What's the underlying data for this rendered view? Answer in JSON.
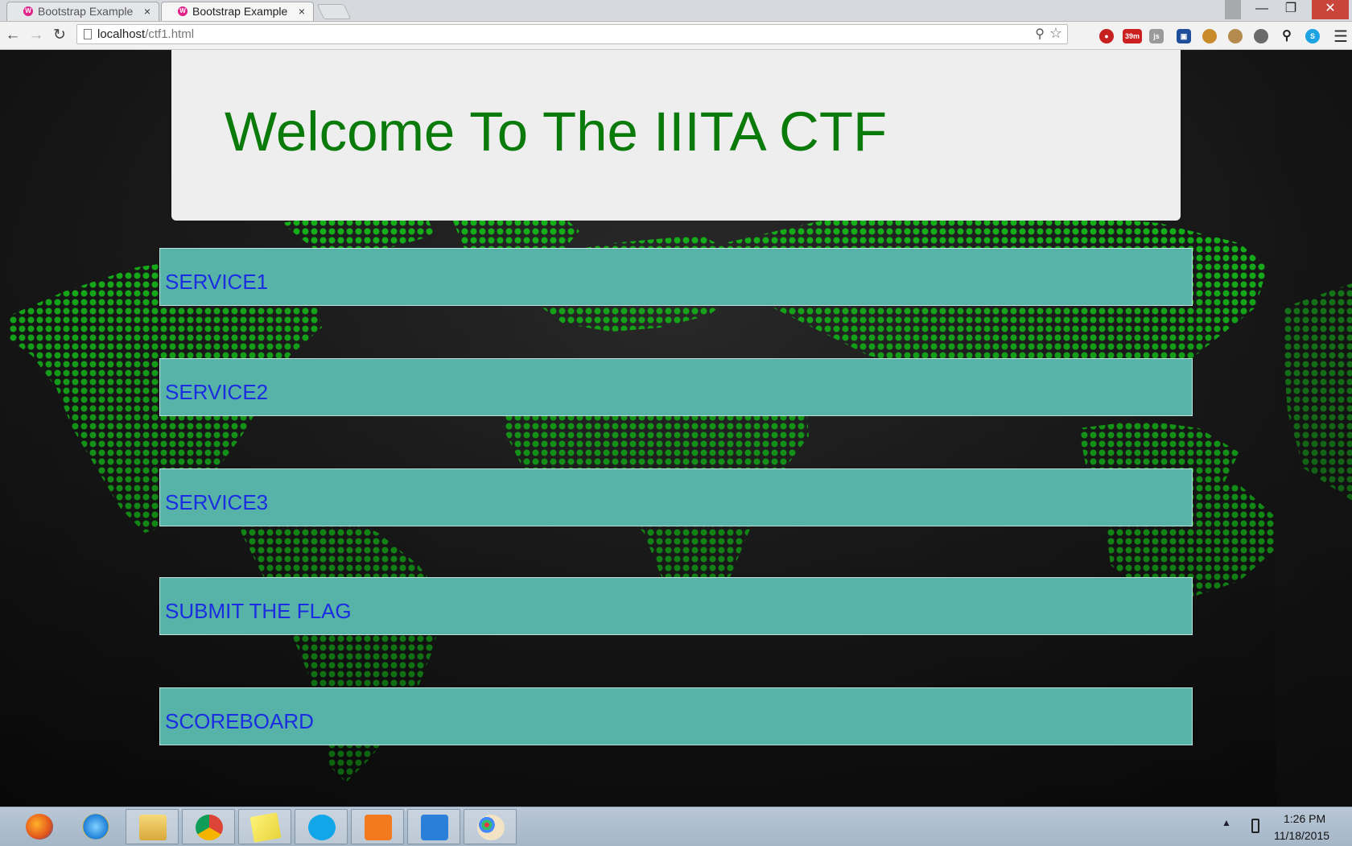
{
  "browser": {
    "tabs": [
      {
        "title": "Bootstrap Example",
        "close": "×",
        "favicon": "W"
      },
      {
        "title": "Bootstrap Example",
        "close": "×",
        "favicon": "W"
      }
    ],
    "url_host": "localhost",
    "url_path": "/ctf1.html",
    "icons": {
      "back": "back-arrow-icon",
      "forward": "forward-arrow-icon",
      "reload": "reload-icon",
      "zoom": "zoom-icon",
      "star": "bookmark-star-icon",
      "menu": "hamburger-menu-icon"
    },
    "extension_badge": "39m",
    "window_controls": {
      "minimize": "—",
      "restore": "❐",
      "close": "✕"
    }
  },
  "page": {
    "title": "Welcome To The IIITA CTF",
    "title_color": "#0a7a0a",
    "bar_color": "#57b2a8",
    "link_color": "#1a2de0",
    "menu": [
      {
        "label": "SERVICE1"
      },
      {
        "label": "SERVICE2"
      },
      {
        "label": "SERVICE3"
      },
      {
        "label": "SUBMIT THE FLAG"
      },
      {
        "label": "SCOREBOARD"
      }
    ]
  },
  "taskbar": {
    "apps": [
      "firefox-icon",
      "internet-explorer-icon",
      "file-explorer-icon",
      "chrome-icon",
      "sticky-notes-icon",
      "skype-icon",
      "xampp-icon",
      "network-app-icon",
      "paint-icon"
    ],
    "clock_time": "1:26 PM",
    "clock_date": "11/18/2015"
  }
}
